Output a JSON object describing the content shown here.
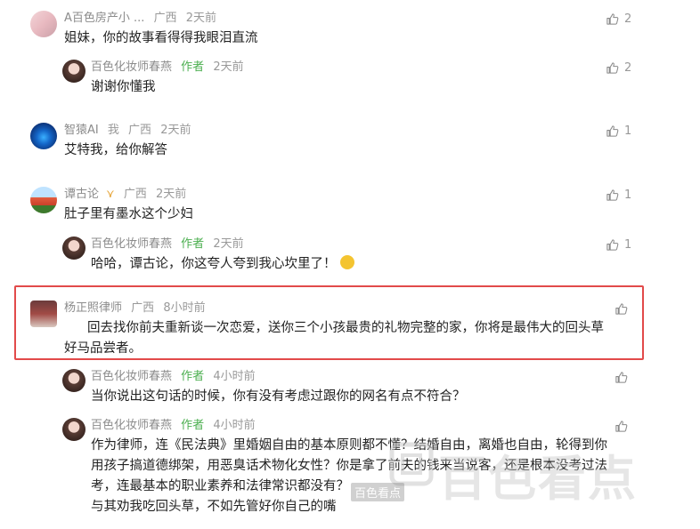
{
  "comments": [
    {
      "name": "A百色房产小 ...",
      "location": "广西",
      "time": "2天前",
      "author_tag": "",
      "text": "姐妹，你的故事看得得我眼泪直流",
      "likes": "2"
    },
    {
      "name": "百色化妆师春燕",
      "location": "",
      "time": "2天前",
      "author_tag": "作者",
      "text": "谢谢你懂我",
      "likes": "2"
    },
    {
      "name": "智猿AI",
      "extra": "我",
      "location": "广西",
      "time": "2天前",
      "author_tag": "",
      "text": "艾特我，给你解答",
      "likes": "1"
    },
    {
      "name": "谭古论",
      "location": "广西",
      "time": "2天前",
      "author_tag": "",
      "text": "肚子里有墨水这个少妇",
      "likes": "1"
    },
    {
      "name": "百色化妆师春燕",
      "location": "",
      "time": "2天前",
      "author_tag": "作者",
      "text": "哈哈，谭古论，你这夸人夸到我心坎里了！",
      "likes": "1"
    },
    {
      "name": "杨正照律师",
      "location": "广西",
      "time": "8小时前",
      "author_tag": "",
      "text_line1": "回去找你前夫重新谈一次恋爱，送你三个小孩最贵的礼物完整的家，你将是最伟大的回头草",
      "text_line2": "好马品尝者。",
      "likes": ""
    },
    {
      "name": "百色化妆师春燕",
      "location": "",
      "time": "4小时前",
      "author_tag": "作者",
      "text": "当你说出这句话的时候，你有没有考虑过跟你的网名有点不符合？",
      "likes": ""
    },
    {
      "name": "百色化妆师春燕",
      "location": "",
      "time": "4小时前",
      "author_tag": "作者",
      "text_line1": "作为律师，连《民法典》里婚姻自由的基本原则都不懂？结婚自由，离婚也自由，轮得到你",
      "text_line2": "用孩子搞道德绑架，用恶臭话术物化女性？你是拿了前夫的钱来当说客，还是根本没考过法",
      "text_line3": "考，连最基本的职业素养和法律常识都没有？",
      "text_line4": "与其劝我吃回头草，不如先管好你自己的嘴",
      "likes": ""
    }
  ],
  "watermark": {
    "big": "百色看点",
    "small": "百色看点"
  },
  "colors": {
    "highlight": "#e24a4a",
    "author": "#4caf50"
  }
}
